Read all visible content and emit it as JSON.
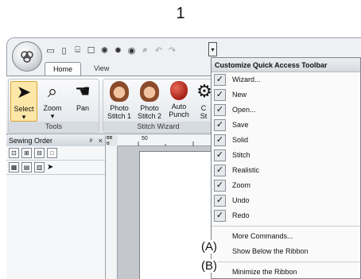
{
  "figure": {
    "step_number": "1",
    "callout_a": "(A)",
    "callout_b": "(B)"
  },
  "quick_access": {
    "icons": [
      "new-file-icon",
      "open-file-icon",
      "save-icon",
      "wizard-icon",
      "realistic-icon",
      "stitch-icon",
      "zoom-icon",
      "undo-icon",
      "redo-icon"
    ],
    "customize_icon": "customize-qat-icon"
  },
  "tabs": [
    {
      "label": "Home",
      "active": true
    },
    {
      "label": "View",
      "active": false
    }
  ],
  "ribbon": {
    "groups": [
      {
        "label": "Tools",
        "buttons": [
          {
            "label": "Select",
            "icon": "arrow-cursor-icon"
          },
          {
            "label": "Zoom",
            "icon": "magnifier-icon"
          },
          {
            "label": "Pan",
            "icon": "hand-icon"
          }
        ]
      },
      {
        "label": "Stitch Wizard",
        "buttons": [
          {
            "label": "Photo Stitch 1",
            "icon": "portrait-icon"
          },
          {
            "label": "Photo Stitch 2",
            "icon": "portrait-icon"
          },
          {
            "label": "Auto Punch",
            "icon": "apple-icon"
          },
          {
            "label": "C",
            "icon": "gear-icon"
          }
        ]
      }
    ],
    "wrap_suffix": "St",
    "dropdown_marker": "▾"
  },
  "sewing_order": {
    "title": "Sewing Order",
    "pin": "ᵖ",
    "close": "×"
  },
  "ruler": {
    "corner_top": "ʙʙ",
    "corner_side": "ʁ",
    "top_value": "50"
  },
  "dropdown": {
    "title": "Customize Quick Access Toolbar",
    "check_mark": "✓",
    "items": [
      {
        "label": "Wizard...",
        "checked": true
      },
      {
        "label": "New",
        "checked": true
      },
      {
        "label": "Open...",
        "checked": true
      },
      {
        "label": "Save",
        "checked": true
      },
      {
        "label": "Solid",
        "checked": true
      },
      {
        "label": "Stitch",
        "checked": true
      },
      {
        "label": "Realistic",
        "checked": true
      },
      {
        "label": "Zoom",
        "checked": true
      },
      {
        "label": "Undo",
        "checked": true
      },
      {
        "label": "Redo",
        "checked": true
      }
    ],
    "more_commands": "More Commands...",
    "show_below": "Show Below the Ribbon",
    "minimize": "Minimize the Ribbon"
  }
}
